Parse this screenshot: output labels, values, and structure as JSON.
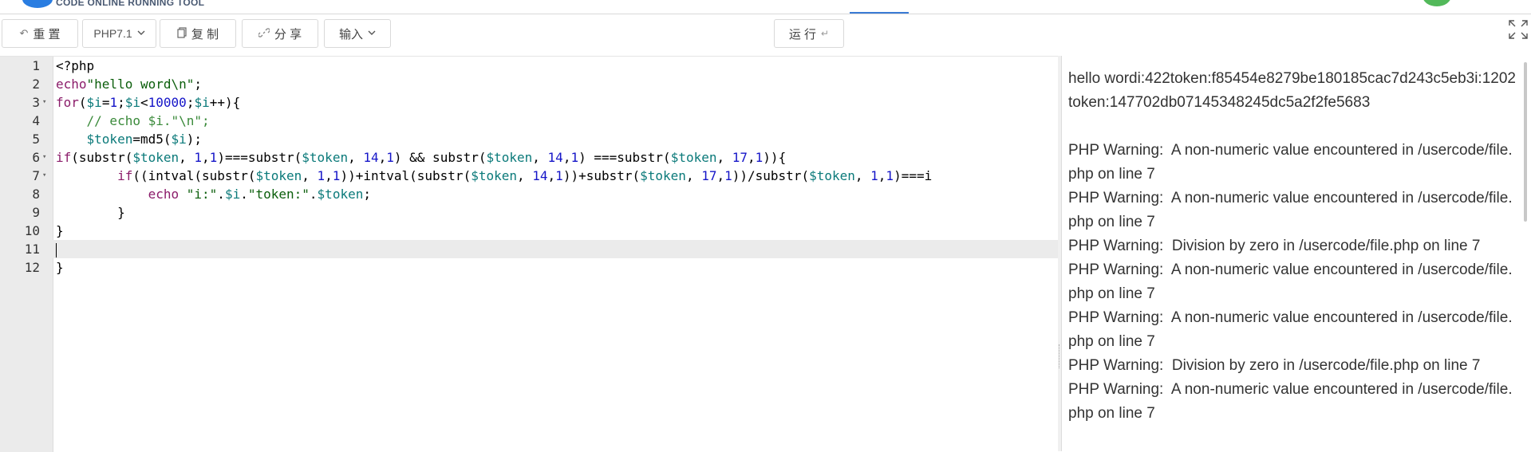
{
  "header": {
    "logo_text": "CODE ONLINE RUNNING TOOL"
  },
  "toolbar": {
    "reset_label": "重 置",
    "language_label": "PHP7.1",
    "copy_label": "复 制",
    "share_label": "分 享",
    "input_label": "输入",
    "run_label": "运 行"
  },
  "editor": {
    "line_numbers": [
      "1",
      "2",
      "3",
      "4",
      "5",
      "6",
      "7",
      "8",
      "9",
      "10",
      "11",
      "12"
    ],
    "lines": [
      "<?php",
      "echo\"hello word\\n\";",
      "for($i=1;$i<10000;$i++){",
      "    // echo $i.\"\\n\";",
      "    $token=md5($i);",
      "if(substr($token, 1,1)===substr($token, 14,1) && substr($token, 14,1) ===substr($token, 17,1)){",
      "        if((intval(substr($token, 1,1))+intval(substr($token, 14,1))+substr($token, 17,1))/substr($token, 1,1)===i",
      "            echo \"i:\".$i.\"token:\".$token;",
      "        }",
      "}",
      "",
      "}"
    ]
  },
  "output": {
    "lines": [
      "hello wordi:422token:f85454e8279be180185cac7d243c5eb3i:1202token:147702db07145348245dc5a2f2fe5683",
      "",
      "PHP Warning:  A non-numeric value encountered in /usercode/file.php on line 7",
      "PHP Warning:  A non-numeric value encountered in /usercode/file.php on line 7",
      "PHP Warning:  Division by zero in /usercode/file.php on line 7",
      "PHP Warning:  A non-numeric value encountered in /usercode/file.php on line 7",
      "PHP Warning:  A non-numeric value encountered in /usercode/file.php on line 7",
      "PHP Warning:  Division by zero in /usercode/file.php on line 7",
      "PHP Warning:  A non-numeric value encountered in /usercode/file.php on line 7"
    ]
  }
}
